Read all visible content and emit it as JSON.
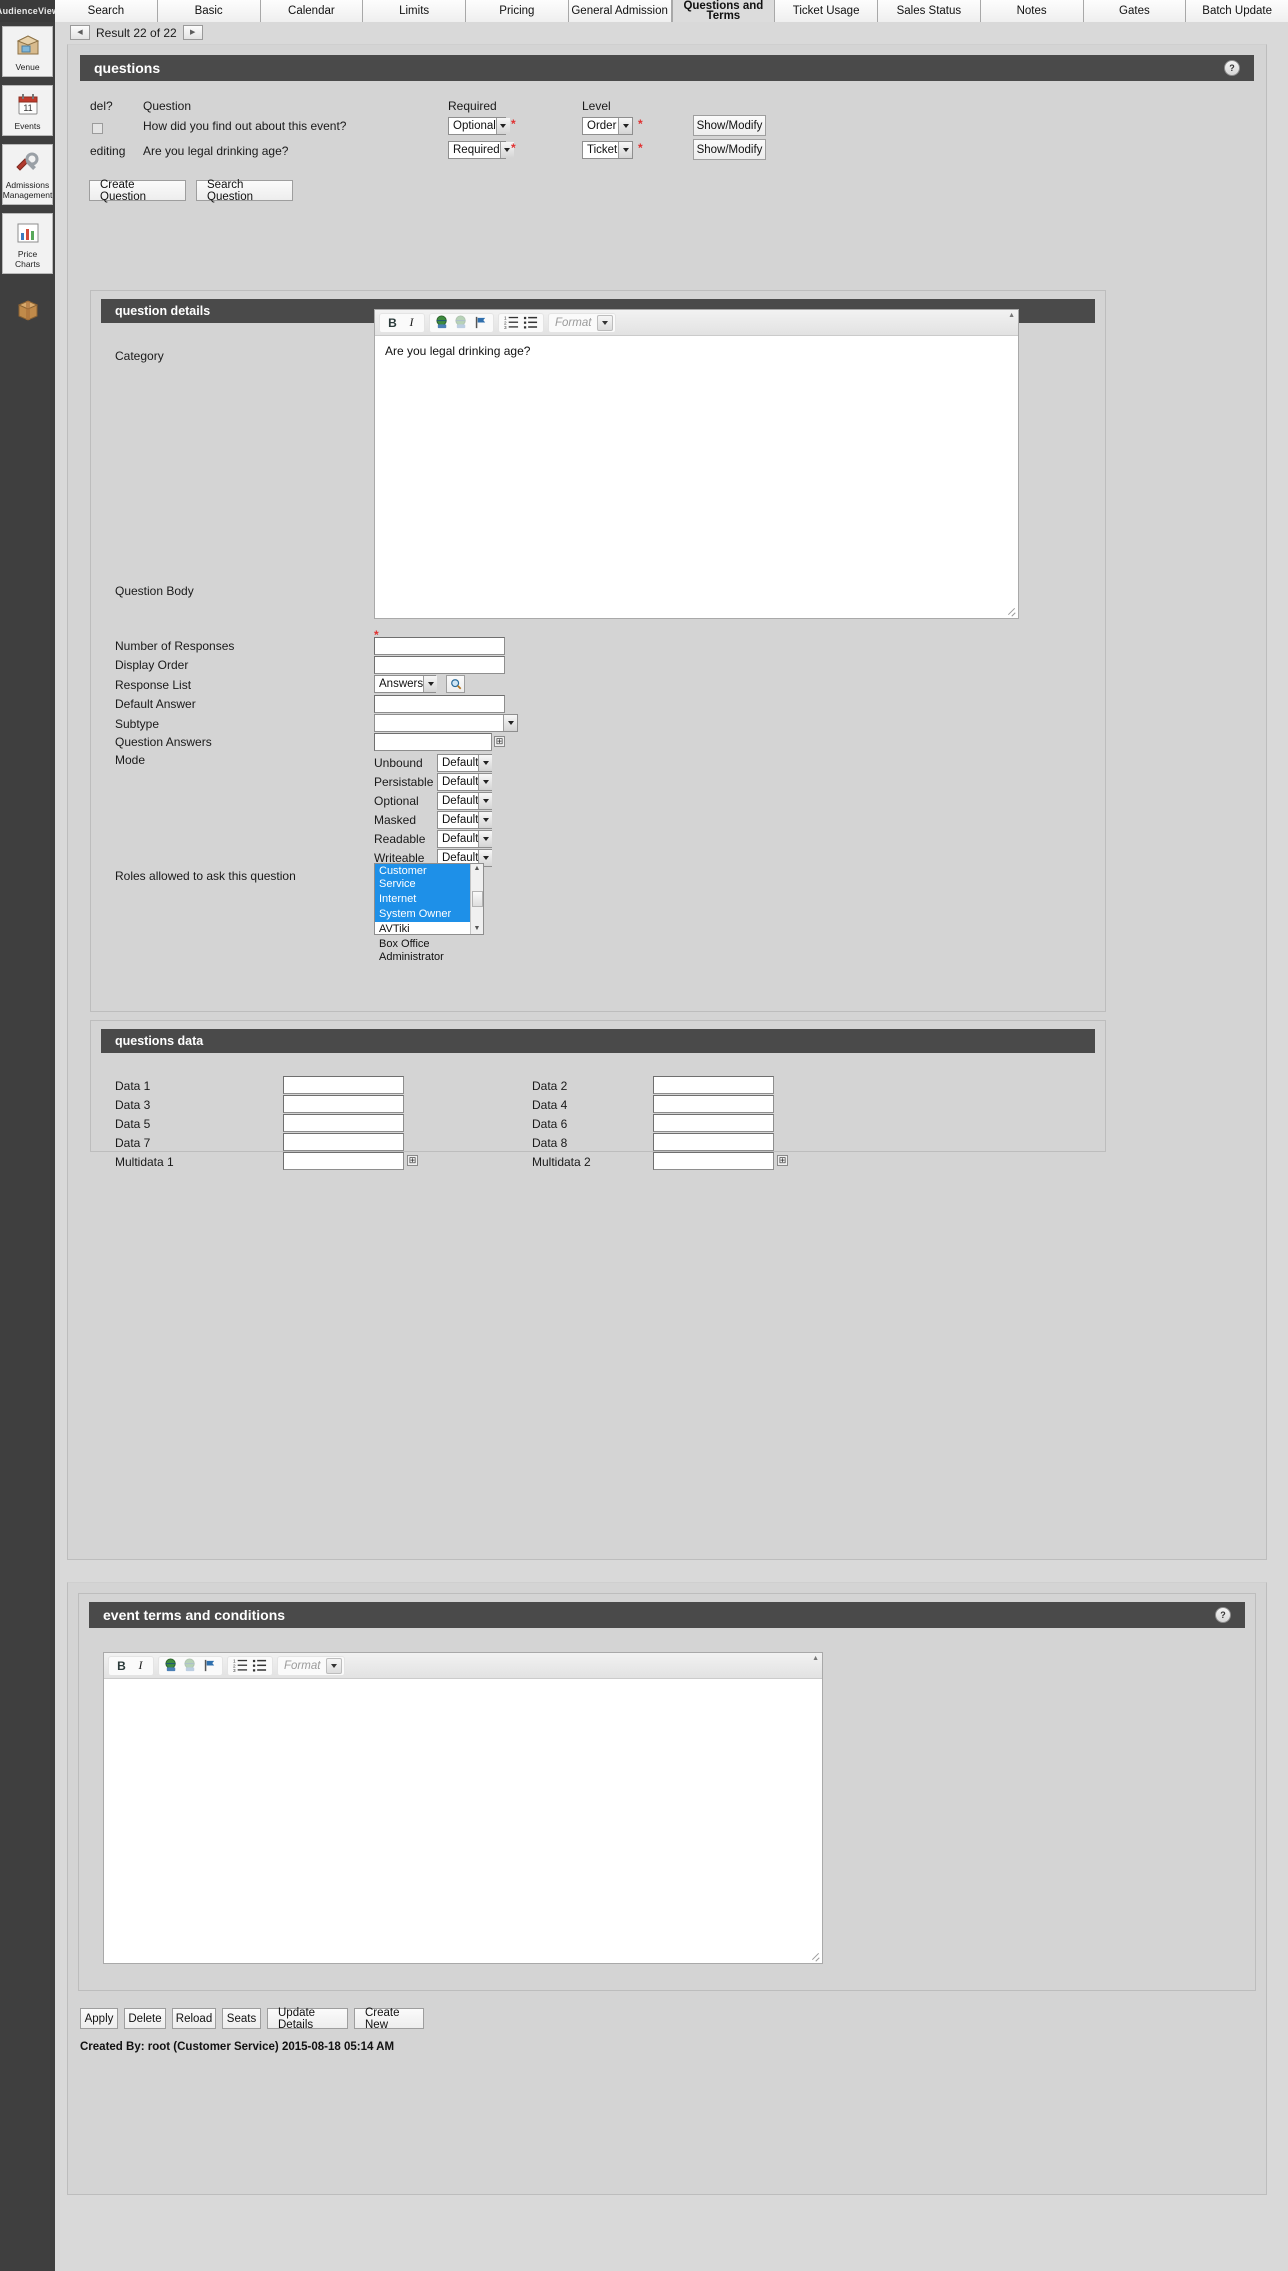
{
  "brand": {
    "name": "AudienceView"
  },
  "rail": {
    "items": [
      {
        "label": "Venue",
        "icon": "venue-box-icon"
      },
      {
        "label": "Events",
        "icon": "calendar-icon"
      },
      {
        "label": "Admissions Management",
        "icon": "wrench-icon"
      },
      {
        "label": "Price Charts",
        "icon": "chart-icon"
      },
      {
        "label": "",
        "icon": "package-icon"
      }
    ]
  },
  "tabs": [
    {
      "label": "Search",
      "active": false
    },
    {
      "label": "Basic",
      "active": false
    },
    {
      "label": "Calendar",
      "active": false
    },
    {
      "label": "Limits",
      "active": false
    },
    {
      "label": "Pricing",
      "active": false
    },
    {
      "label": "General Admission",
      "active": false
    },
    {
      "label": "Questions and Terms",
      "active": true
    },
    {
      "label": "Ticket Usage",
      "active": false
    },
    {
      "label": "Sales Status",
      "active": false
    },
    {
      "label": "Notes",
      "active": false
    },
    {
      "label": "Gates",
      "active": false
    },
    {
      "label": "Batch Update",
      "active": false
    }
  ],
  "result_nav": {
    "text": "Result 22 of 22",
    "prev_icon": "left-arrow-icon",
    "next_icon": "right-arrow-icon"
  },
  "questions_section": {
    "title": "questions",
    "help_icon": "help-circle-icon",
    "columns": {
      "del": "del?",
      "question": "Question",
      "required": "Required",
      "level": "Level"
    },
    "rows": [
      {
        "del_state": "checkbox",
        "del_label": "",
        "question": "How did you find out about this event?",
        "required": "Optional",
        "level": "Order",
        "action": "Show/Modify"
      },
      {
        "del_state": "text",
        "del_label": "editing",
        "question": "Are you legal drinking age?",
        "required": "Required",
        "level": "Ticket",
        "action": "Show/Modify"
      }
    ],
    "buttons": [
      "Create Question",
      "Search Question"
    ]
  },
  "question_details": {
    "title": "question details",
    "category_label": "Category",
    "category_value": "",
    "body_label": "Question Body",
    "body_value": "Are you legal drinking age?",
    "editor_toolbar": {
      "bold": "B",
      "italic": "I",
      "link": "insert-link-icon",
      "unlink": "remove-link-icon",
      "anchor": "anchor-flag-icon",
      "ordered_list": "numbered-list-icon",
      "unordered_list": "bullet-list-icon",
      "format_placeholder": "Format"
    },
    "fields": [
      {
        "label": "Number of Responses",
        "value": "",
        "type": "text"
      },
      {
        "label": "Display Order",
        "value": "",
        "type": "text"
      },
      {
        "label": "Response List",
        "value": "Answers",
        "type": "select-search"
      },
      {
        "label": "Default Answer",
        "value": "",
        "type": "text"
      },
      {
        "label": "Subtype",
        "value": "",
        "type": "select"
      },
      {
        "label": "Question Answers",
        "value": "",
        "type": "text-plus"
      }
    ],
    "search_icon": "magnifier-icon",
    "mode_label": "Mode",
    "mode_rows": [
      {
        "label": "Unbound",
        "value": "Default"
      },
      {
        "label": "Persistable",
        "value": "Default"
      },
      {
        "label": "Optional",
        "value": "Default"
      },
      {
        "label": "Masked",
        "value": "Default"
      },
      {
        "label": "Readable",
        "value": "Default"
      },
      {
        "label": "Writeable",
        "value": "Default"
      }
    ],
    "roles_label": "Roles allowed to ask this question",
    "roles": [
      {
        "label": "Customer Service",
        "selected": true
      },
      {
        "label": "Internet",
        "selected": true
      },
      {
        "label": "System Owner",
        "selected": true
      },
      {
        "label": "AVTiki",
        "selected": false
      },
      {
        "label": "Box Office Administrator",
        "selected": false
      }
    ]
  },
  "questions_data": {
    "title": "questions data",
    "left": [
      {
        "label": "Data 1",
        "value": ""
      },
      {
        "label": "Data 3",
        "value": ""
      },
      {
        "label": "Data 5",
        "value": ""
      },
      {
        "label": "Data 7",
        "value": ""
      },
      {
        "label": "Multidata 1",
        "value": "",
        "plus": true
      }
    ],
    "right": [
      {
        "label": "Data 2",
        "value": ""
      },
      {
        "label": "Data 4",
        "value": ""
      },
      {
        "label": "Data 6",
        "value": ""
      },
      {
        "label": "Data 8",
        "value": ""
      },
      {
        "label": "Multidata 2",
        "value": "",
        "plus": true
      }
    ]
  },
  "terms_section": {
    "title": "event terms and conditions",
    "help_icon": "help-circle-icon",
    "body_value": "",
    "editor_toolbar": {
      "bold": "B",
      "italic": "I",
      "link": "insert-link-icon",
      "unlink": "remove-link-icon",
      "anchor": "anchor-flag-icon",
      "ordered_list": "numbered-list-icon",
      "unordered_list": "bullet-list-icon",
      "format_placeholder": "Format"
    }
  },
  "footer": {
    "buttons": [
      "Apply",
      "Delete",
      "Reload",
      "Seats",
      "Update Details",
      "Create New"
    ],
    "created_by": "Created By: root (Customer Service) 2015-08-18 05:14 AM"
  }
}
